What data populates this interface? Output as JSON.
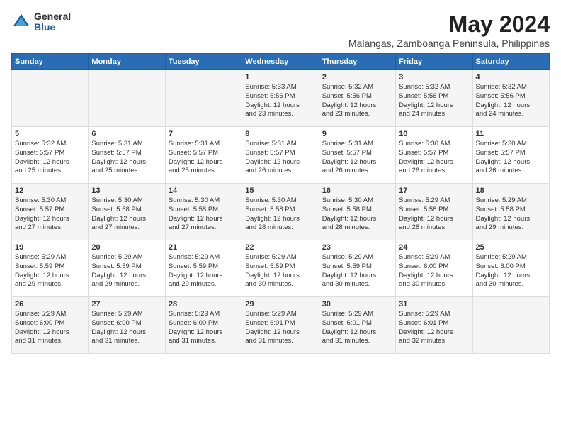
{
  "logo": {
    "general": "General",
    "blue": "Blue"
  },
  "title": "May 2024",
  "subtitle": "Malangas, Zamboanga Peninsula, Philippines",
  "days_header": [
    "Sunday",
    "Monday",
    "Tuesday",
    "Wednesday",
    "Thursday",
    "Friday",
    "Saturday"
  ],
  "weeks": [
    {
      "cells": [
        {
          "day": "",
          "content": ""
        },
        {
          "day": "",
          "content": ""
        },
        {
          "day": "",
          "content": ""
        },
        {
          "day": "1",
          "content": "Sunrise: 5:33 AM\nSunset: 5:56 PM\nDaylight: 12 hours\nand 23 minutes."
        },
        {
          "day": "2",
          "content": "Sunrise: 5:32 AM\nSunset: 5:56 PM\nDaylight: 12 hours\nand 23 minutes."
        },
        {
          "day": "3",
          "content": "Sunrise: 5:32 AM\nSunset: 5:56 PM\nDaylight: 12 hours\nand 24 minutes."
        },
        {
          "day": "4",
          "content": "Sunrise: 5:32 AM\nSunset: 5:56 PM\nDaylight: 12 hours\nand 24 minutes."
        }
      ]
    },
    {
      "cells": [
        {
          "day": "5",
          "content": "Sunrise: 5:32 AM\nSunset: 5:57 PM\nDaylight: 12 hours\nand 25 minutes."
        },
        {
          "day": "6",
          "content": "Sunrise: 5:31 AM\nSunset: 5:57 PM\nDaylight: 12 hours\nand 25 minutes."
        },
        {
          "day": "7",
          "content": "Sunrise: 5:31 AM\nSunset: 5:57 PM\nDaylight: 12 hours\nand 25 minutes."
        },
        {
          "day": "8",
          "content": "Sunrise: 5:31 AM\nSunset: 5:57 PM\nDaylight: 12 hours\nand 26 minutes."
        },
        {
          "day": "9",
          "content": "Sunrise: 5:31 AM\nSunset: 5:57 PM\nDaylight: 12 hours\nand 26 minutes."
        },
        {
          "day": "10",
          "content": "Sunrise: 5:30 AM\nSunset: 5:57 PM\nDaylight: 12 hours\nand 26 minutes."
        },
        {
          "day": "11",
          "content": "Sunrise: 5:30 AM\nSunset: 5:57 PM\nDaylight: 12 hours\nand 26 minutes."
        }
      ]
    },
    {
      "cells": [
        {
          "day": "12",
          "content": "Sunrise: 5:30 AM\nSunset: 5:57 PM\nDaylight: 12 hours\nand 27 minutes."
        },
        {
          "day": "13",
          "content": "Sunrise: 5:30 AM\nSunset: 5:58 PM\nDaylight: 12 hours\nand 27 minutes."
        },
        {
          "day": "14",
          "content": "Sunrise: 5:30 AM\nSunset: 5:58 PM\nDaylight: 12 hours\nand 27 minutes."
        },
        {
          "day": "15",
          "content": "Sunrise: 5:30 AM\nSunset: 5:58 PM\nDaylight: 12 hours\nand 28 minutes."
        },
        {
          "day": "16",
          "content": "Sunrise: 5:30 AM\nSunset: 5:58 PM\nDaylight: 12 hours\nand 28 minutes."
        },
        {
          "day": "17",
          "content": "Sunrise: 5:29 AM\nSunset: 5:58 PM\nDaylight: 12 hours\nand 28 minutes."
        },
        {
          "day": "18",
          "content": "Sunrise: 5:29 AM\nSunset: 5:58 PM\nDaylight: 12 hours\nand 29 minutes."
        }
      ]
    },
    {
      "cells": [
        {
          "day": "19",
          "content": "Sunrise: 5:29 AM\nSunset: 5:59 PM\nDaylight: 12 hours\nand 29 minutes."
        },
        {
          "day": "20",
          "content": "Sunrise: 5:29 AM\nSunset: 5:59 PM\nDaylight: 12 hours\nand 29 minutes."
        },
        {
          "day": "21",
          "content": "Sunrise: 5:29 AM\nSunset: 5:59 PM\nDaylight: 12 hours\nand 29 minutes."
        },
        {
          "day": "22",
          "content": "Sunrise: 5:29 AM\nSunset: 5:59 PM\nDaylight: 12 hours\nand 30 minutes."
        },
        {
          "day": "23",
          "content": "Sunrise: 5:29 AM\nSunset: 5:59 PM\nDaylight: 12 hours\nand 30 minutes."
        },
        {
          "day": "24",
          "content": "Sunrise: 5:29 AM\nSunset: 6:00 PM\nDaylight: 12 hours\nand 30 minutes."
        },
        {
          "day": "25",
          "content": "Sunrise: 5:29 AM\nSunset: 6:00 PM\nDaylight: 12 hours\nand 30 minutes."
        }
      ]
    },
    {
      "cells": [
        {
          "day": "26",
          "content": "Sunrise: 5:29 AM\nSunset: 6:00 PM\nDaylight: 12 hours\nand 31 minutes."
        },
        {
          "day": "27",
          "content": "Sunrise: 5:29 AM\nSunset: 6:00 PM\nDaylight: 12 hours\nand 31 minutes."
        },
        {
          "day": "28",
          "content": "Sunrise: 5:29 AM\nSunset: 6:00 PM\nDaylight: 12 hours\nand 31 minutes."
        },
        {
          "day": "29",
          "content": "Sunrise: 5:29 AM\nSunset: 6:01 PM\nDaylight: 12 hours\nand 31 minutes."
        },
        {
          "day": "30",
          "content": "Sunrise: 5:29 AM\nSunset: 6:01 PM\nDaylight: 12 hours\nand 31 minutes."
        },
        {
          "day": "31",
          "content": "Sunrise: 5:29 AM\nSunset: 6:01 PM\nDaylight: 12 hours\nand 32 minutes."
        },
        {
          "day": "",
          "content": ""
        }
      ]
    }
  ]
}
